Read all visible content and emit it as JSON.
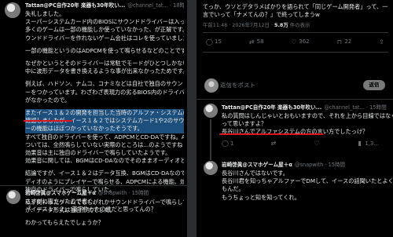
{
  "left_post": {
    "name": "Tattan@PC自作20年 楽器も30年吹い...",
    "handle": "@channel_tat... · 18時間",
    "lines": [
      "失礼しました。",
      "スーパーシステムカード内のBIOSにサウンドドライバーは入ってましたが、",
      "多くのゲームは一部の機能しか使っていなかった、が正解です。自前でサ",
      "ウンドドライバーを作れないゲーム会社はコレを使っていました。",
      "",
      "一部の機能というのはADPCMを使って鳴らせるなどのことです。",
      "",
      "なぜかというとそのドライバーは常駐でモードがひとつしかないビプラートが使えなかったり、波形",
      "中に波形データを書き換えるような事が出来なかったためです。",
      "",
      "例えば、ハドソン、ナムコ、コナミなどは自社で独自のサウンドドライバ",
      "ーをつかっています。わざわざ表現力の劣るBIOS内のドライバーを使う必要",
      "がなかったので。",
      "",
      "またイース１＆２の開発を担当した当時のアルファ・システムの方にDMで",
      "確認しましたが、イース１＆２ではシステムカード1や2のサウンドドライバ",
      "ーの機能はほぼつかっていなかったそうです。",
      "すべて独自のドライバーを使って、ADPCMとCD-DAですね。ADPCMに",
      "ついては、全然鳴らしていない実際のところは...のようですね",
      "効果音は主に独自のドライバーで鳴らしていたようです。",
      "効果音に関しては、BGMはCD-DAなのでそのままオーディオとして...",
      "",
      "結論ですが、イース１＆２はデータ互換、BGMはCD-DAなのでそのままオー",
      "ディオのようにプレイヤーで鳴らせる、ADPCMによる機能、効果音に関しても",
      "独自のドライバーで鳴らしていた。",
      "",
      "私が関わったゲームでもむがれかサウンドドライバーで鳴らしていました",
      "が、データ形式は独自形式でした。",
      "",
      "わかってもらえたでしょうか？"
    ]
  },
  "left_reply": {
    "name": "岩崎啓眞@スマホゲーム屋＋α",
    "handle": "@snapwith · 15時間",
    "lines": [
      "さすがに腹立ったので書く。",
      "「イース１・２」 漢字作ったの誰だと思ってんの？"
    ]
  },
  "right_post": {
    "lines": [
      "てっか、ウソとデタラメばかりを語られて「同じゲーム開発者」って、一",
      "言でいって「ナメてんの？」で終ってしまうw"
    ],
    "meta_time": "午前11:48 · 2026年7月12日 · ",
    "meta_views": "5.8万",
    "meta_views_label": " 件の表示"
  },
  "right_actions": {
    "reply": "15",
    "retweet": "58",
    "like": "362",
    "bookmark": "22"
  },
  "reply_box": {
    "placeholder": "返信をポスト",
    "button": "返信"
  },
  "right_reply1": {
    "name": "Tattan@PC自作20年 楽器も30年吹い...",
    "handle": "@channel_tat... · 15時間",
    "lines": [
      "私の質問はしんじゃいとおもいますので、それを上から目線ではなくそれ",
      "って思いますよ？",
      "長谷川さんでアルファシステムの方の言い方でしたっけ？"
    ],
    "actions": {
      "reply": "1",
      "retweet": "",
      "like": "",
      "views": "1,3..."
    }
  },
  "right_reply2": {
    "name": "岩崎啓眞@スマホゲーム屋＋α",
    "handle": "@snapwith · 15時間",
    "lines": [
      "長谷川さんではないです。",
      "長谷川君を知っちゃアルファーでDMして、イースの話聞いたとよく書ける",
      "もんだ。",
      "もうちょっと知を知ってくれ。"
    ]
  }
}
